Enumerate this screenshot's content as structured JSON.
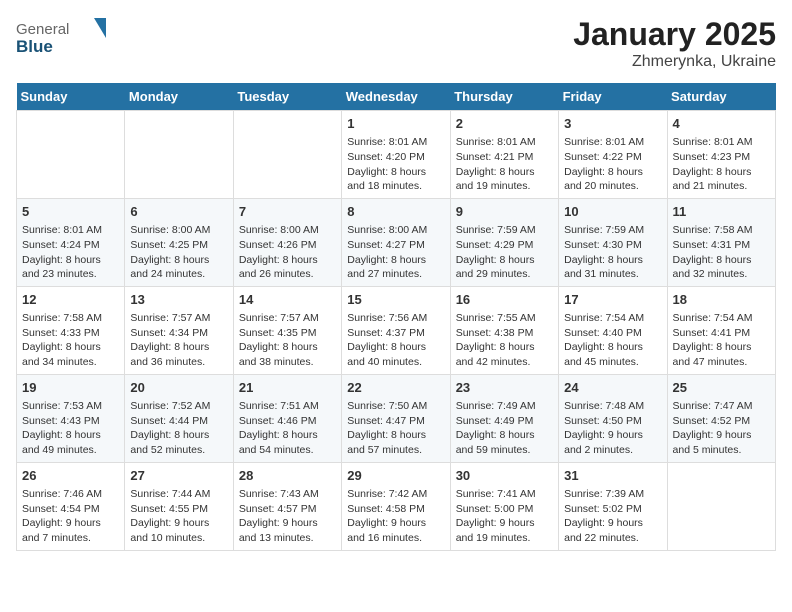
{
  "logo": {
    "line1": "General",
    "line2": "Blue"
  },
  "title": "January 2025",
  "subtitle": "Zhmerynka, Ukraine",
  "weekdays": [
    "Sunday",
    "Monday",
    "Tuesday",
    "Wednesday",
    "Thursday",
    "Friday",
    "Saturday"
  ],
  "weeks": [
    [
      {
        "day": "",
        "content": ""
      },
      {
        "day": "",
        "content": ""
      },
      {
        "day": "",
        "content": ""
      },
      {
        "day": "1",
        "content": "Sunrise: 8:01 AM\nSunset: 4:20 PM\nDaylight: 8 hours\nand 18 minutes."
      },
      {
        "day": "2",
        "content": "Sunrise: 8:01 AM\nSunset: 4:21 PM\nDaylight: 8 hours\nand 19 minutes."
      },
      {
        "day": "3",
        "content": "Sunrise: 8:01 AM\nSunset: 4:22 PM\nDaylight: 8 hours\nand 20 minutes."
      },
      {
        "day": "4",
        "content": "Sunrise: 8:01 AM\nSunset: 4:23 PM\nDaylight: 8 hours\nand 21 minutes."
      }
    ],
    [
      {
        "day": "5",
        "content": "Sunrise: 8:01 AM\nSunset: 4:24 PM\nDaylight: 8 hours\nand 23 minutes."
      },
      {
        "day": "6",
        "content": "Sunrise: 8:00 AM\nSunset: 4:25 PM\nDaylight: 8 hours\nand 24 minutes."
      },
      {
        "day": "7",
        "content": "Sunrise: 8:00 AM\nSunset: 4:26 PM\nDaylight: 8 hours\nand 26 minutes."
      },
      {
        "day": "8",
        "content": "Sunrise: 8:00 AM\nSunset: 4:27 PM\nDaylight: 8 hours\nand 27 minutes."
      },
      {
        "day": "9",
        "content": "Sunrise: 7:59 AM\nSunset: 4:29 PM\nDaylight: 8 hours\nand 29 minutes."
      },
      {
        "day": "10",
        "content": "Sunrise: 7:59 AM\nSunset: 4:30 PM\nDaylight: 8 hours\nand 31 minutes."
      },
      {
        "day": "11",
        "content": "Sunrise: 7:58 AM\nSunset: 4:31 PM\nDaylight: 8 hours\nand 32 minutes."
      }
    ],
    [
      {
        "day": "12",
        "content": "Sunrise: 7:58 AM\nSunset: 4:33 PM\nDaylight: 8 hours\nand 34 minutes."
      },
      {
        "day": "13",
        "content": "Sunrise: 7:57 AM\nSunset: 4:34 PM\nDaylight: 8 hours\nand 36 minutes."
      },
      {
        "day": "14",
        "content": "Sunrise: 7:57 AM\nSunset: 4:35 PM\nDaylight: 8 hours\nand 38 minutes."
      },
      {
        "day": "15",
        "content": "Sunrise: 7:56 AM\nSunset: 4:37 PM\nDaylight: 8 hours\nand 40 minutes."
      },
      {
        "day": "16",
        "content": "Sunrise: 7:55 AM\nSunset: 4:38 PM\nDaylight: 8 hours\nand 42 minutes."
      },
      {
        "day": "17",
        "content": "Sunrise: 7:54 AM\nSunset: 4:40 PM\nDaylight: 8 hours\nand 45 minutes."
      },
      {
        "day": "18",
        "content": "Sunrise: 7:54 AM\nSunset: 4:41 PM\nDaylight: 8 hours\nand 47 minutes."
      }
    ],
    [
      {
        "day": "19",
        "content": "Sunrise: 7:53 AM\nSunset: 4:43 PM\nDaylight: 8 hours\nand 49 minutes."
      },
      {
        "day": "20",
        "content": "Sunrise: 7:52 AM\nSunset: 4:44 PM\nDaylight: 8 hours\nand 52 minutes."
      },
      {
        "day": "21",
        "content": "Sunrise: 7:51 AM\nSunset: 4:46 PM\nDaylight: 8 hours\nand 54 minutes."
      },
      {
        "day": "22",
        "content": "Sunrise: 7:50 AM\nSunset: 4:47 PM\nDaylight: 8 hours\nand 57 minutes."
      },
      {
        "day": "23",
        "content": "Sunrise: 7:49 AM\nSunset: 4:49 PM\nDaylight: 8 hours\nand 59 minutes."
      },
      {
        "day": "24",
        "content": "Sunrise: 7:48 AM\nSunset: 4:50 PM\nDaylight: 9 hours\nand 2 minutes."
      },
      {
        "day": "25",
        "content": "Sunrise: 7:47 AM\nSunset: 4:52 PM\nDaylight: 9 hours\nand 5 minutes."
      }
    ],
    [
      {
        "day": "26",
        "content": "Sunrise: 7:46 AM\nSunset: 4:54 PM\nDaylight: 9 hours\nand 7 minutes."
      },
      {
        "day": "27",
        "content": "Sunrise: 7:44 AM\nSunset: 4:55 PM\nDaylight: 9 hours\nand 10 minutes."
      },
      {
        "day": "28",
        "content": "Sunrise: 7:43 AM\nSunset: 4:57 PM\nDaylight: 9 hours\nand 13 minutes."
      },
      {
        "day": "29",
        "content": "Sunrise: 7:42 AM\nSunset: 4:58 PM\nDaylight: 9 hours\nand 16 minutes."
      },
      {
        "day": "30",
        "content": "Sunrise: 7:41 AM\nSunset: 5:00 PM\nDaylight: 9 hours\nand 19 minutes."
      },
      {
        "day": "31",
        "content": "Sunrise: 7:39 AM\nSunset: 5:02 PM\nDaylight: 9 hours\nand 22 minutes."
      },
      {
        "day": "",
        "content": ""
      }
    ]
  ]
}
